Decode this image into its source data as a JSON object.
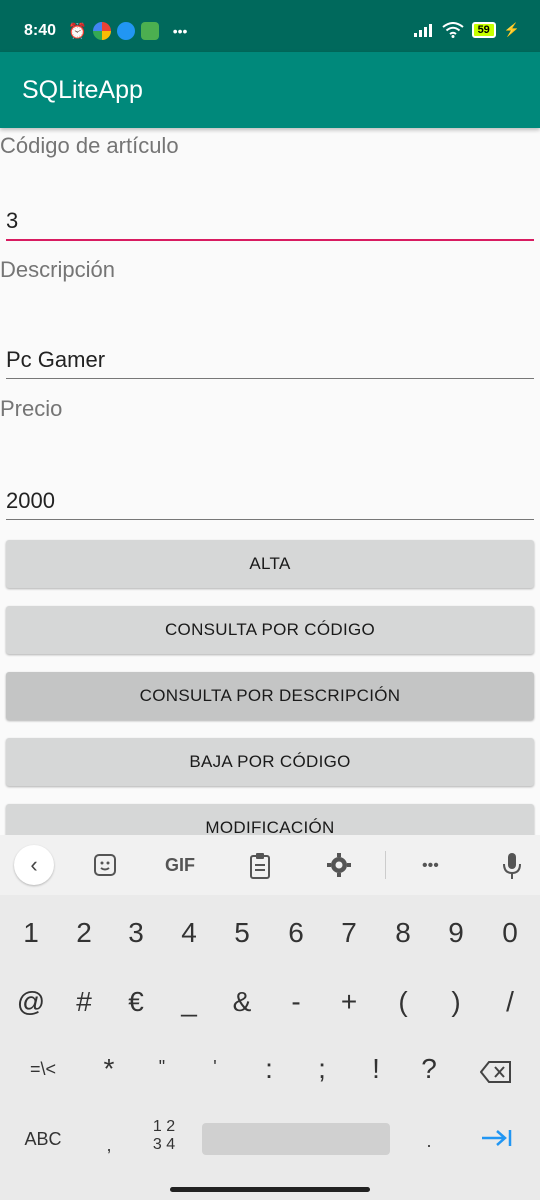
{
  "status_bar": {
    "time": "8:40",
    "dots": "•••",
    "battery": "59"
  },
  "app_bar": {
    "title": "SQLiteApp"
  },
  "form": {
    "codigo": {
      "label": "Código de artículo",
      "value": "3"
    },
    "descripcion": {
      "label": "Descripción",
      "value": "Pc Gamer"
    },
    "precio": {
      "label": "Precio",
      "value": "2000"
    }
  },
  "buttons": {
    "alta": "ALTA",
    "consulta_codigo": "CONSULTA POR CÓDIGO",
    "consulta_descripcion": "CONSULTA POR DESCRIPCIÓN",
    "baja_codigo": "BAJA POR CÓDIGO",
    "modificacion": "MODIFICACIÓN"
  },
  "keyboard": {
    "toolbar": {
      "back": "‹",
      "gif": "GIF",
      "more": "•••"
    },
    "row1": [
      "1",
      "2",
      "3",
      "4",
      "5",
      "6",
      "7",
      "8",
      "9",
      "0"
    ],
    "row2": [
      "@",
      "#",
      "€",
      "_",
      "&",
      "-",
      "+",
      "(",
      ")",
      "/"
    ],
    "row3": [
      "=\\<",
      "*",
      "\"",
      "'",
      ":",
      ";",
      "!",
      "?"
    ],
    "row4": {
      "abc": "ABC",
      "comma": ",",
      "numpad_top": "1 2",
      "numpad_bottom": "3 4",
      "period": "."
    }
  },
  "colors": {
    "status_bar": "#00695c",
    "app_bar": "#00897b",
    "focus_underline": "#d81b60",
    "accent_key": "#2196f3"
  }
}
